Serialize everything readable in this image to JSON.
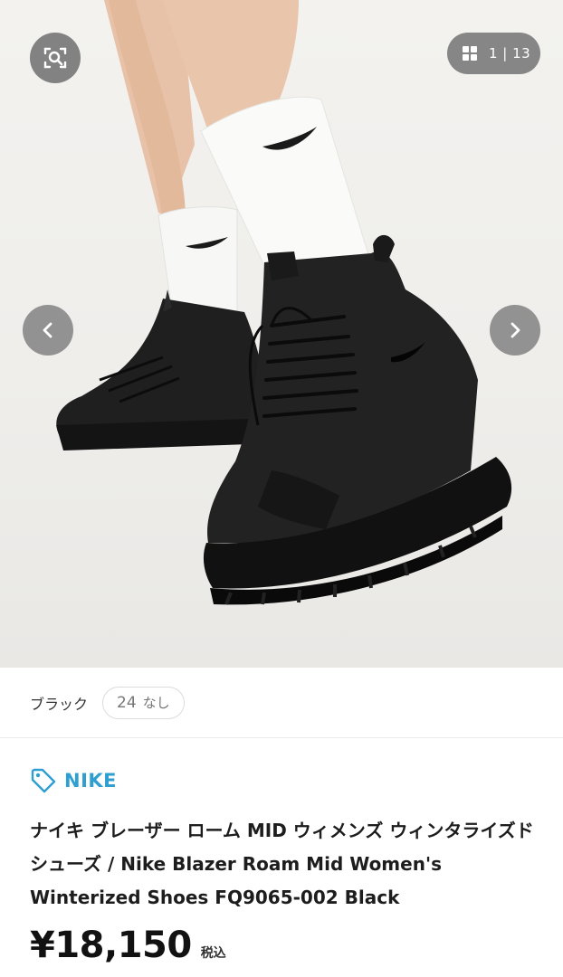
{
  "gallery": {
    "counter": "1 | 13",
    "icons": {
      "lens": "search-lens-icon",
      "grid": "grid-icon",
      "prev": "chevron-left-icon",
      "next": "chevron-right-icon"
    }
  },
  "variant": {
    "color_label": "ブラック",
    "size_value": "24",
    "size_note": "なし"
  },
  "product": {
    "brand": "NIKE",
    "title": "ナイキ ブレーザー ローム MID ウィメンズ ウィンタライズド シューズ / Nike Blazer Roam Mid Women's Winterized Shoes FQ9065-002 Black",
    "price": "¥18,150",
    "tax_label": "税込"
  },
  "colors": {
    "brand_accent": "#2f9fd1",
    "overlay_button": "#787878"
  }
}
